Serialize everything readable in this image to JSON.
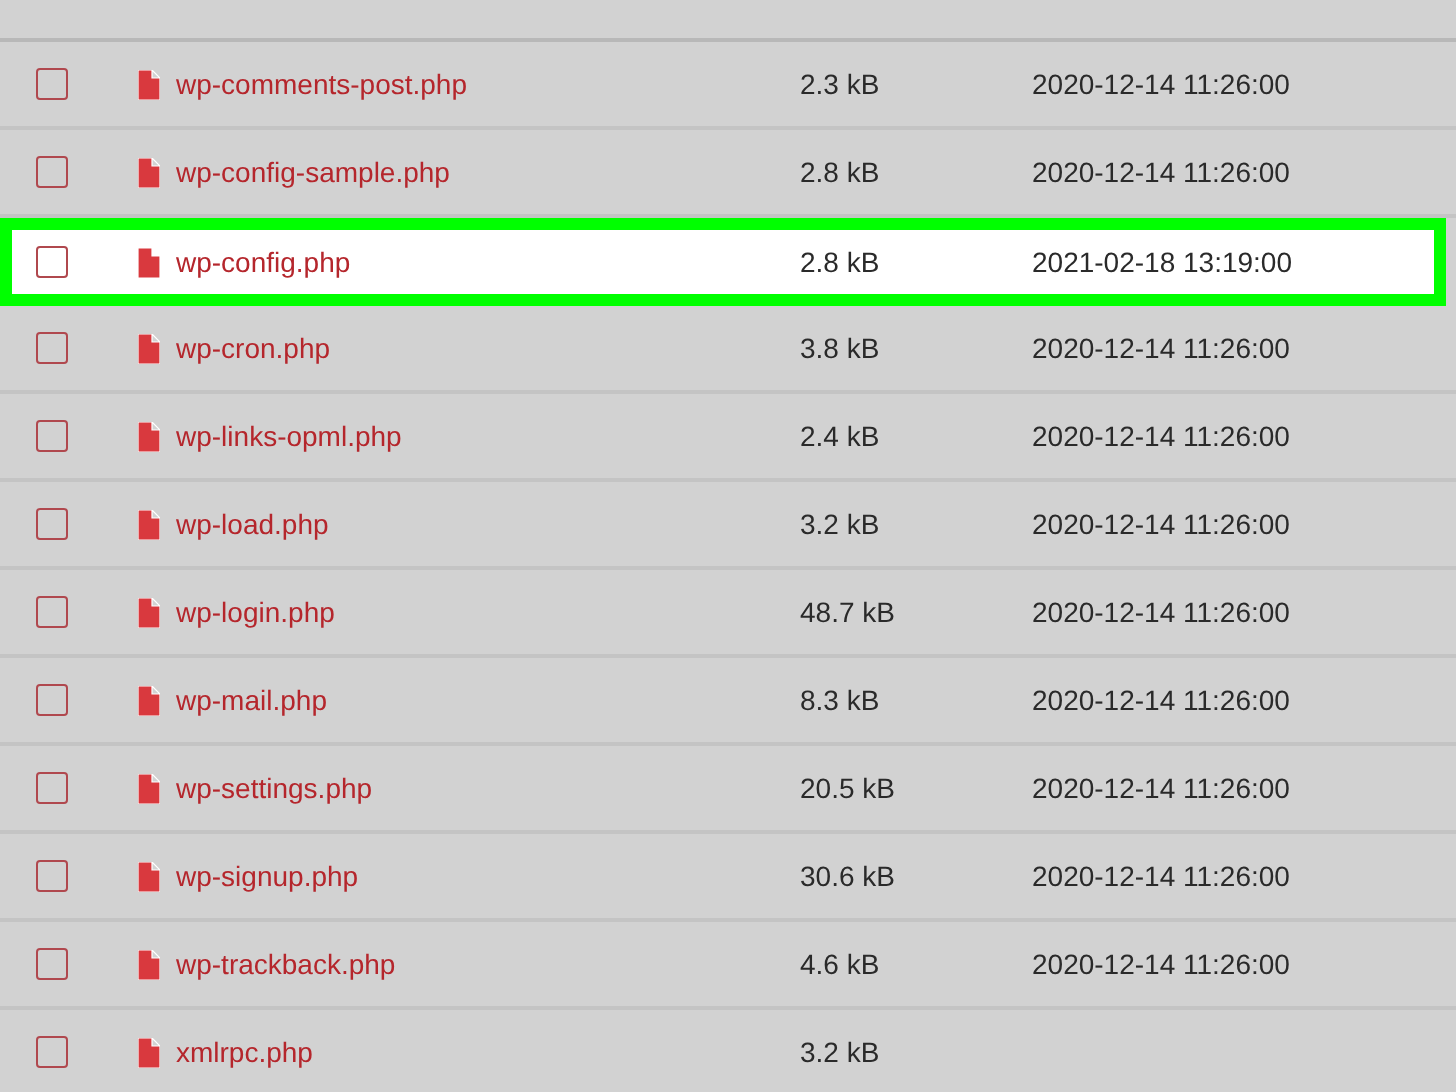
{
  "files": [
    {
      "name": "wp-comments-post.php",
      "size": "2.3 kB",
      "modified": "2020-12-14 11:26:00",
      "selected": false
    },
    {
      "name": "wp-config-sample.php",
      "size": "2.8 kB",
      "modified": "2020-12-14 11:26:00",
      "selected": false
    },
    {
      "name": "wp-config.php",
      "size": "2.8 kB",
      "modified": "2021-02-18 13:19:00",
      "selected": true
    },
    {
      "name": "wp-cron.php",
      "size": "3.8 kB",
      "modified": "2020-12-14 11:26:00",
      "selected": false
    },
    {
      "name": "wp-links-opml.php",
      "size": "2.4 kB",
      "modified": "2020-12-14 11:26:00",
      "selected": false
    },
    {
      "name": "wp-load.php",
      "size": "3.2 kB",
      "modified": "2020-12-14 11:26:00",
      "selected": false
    },
    {
      "name": "wp-login.php",
      "size": "48.7 kB",
      "modified": "2020-12-14 11:26:00",
      "selected": false
    },
    {
      "name": "wp-mail.php",
      "size": "8.3 kB",
      "modified": "2020-12-14 11:26:00",
      "selected": false
    },
    {
      "name": "wp-settings.php",
      "size": "20.5 kB",
      "modified": "2020-12-14 11:26:00",
      "selected": false
    },
    {
      "name": "wp-signup.php",
      "size": "30.6 kB",
      "modified": "2020-12-14 11:26:00",
      "selected": false
    },
    {
      "name": "wp-trackback.php",
      "size": "4.6 kB",
      "modified": "2020-12-14 11:26:00",
      "selected": false
    },
    {
      "name": "xmlrpc.php",
      "size": "3.2 kB",
      "selected": false
    }
  ]
}
